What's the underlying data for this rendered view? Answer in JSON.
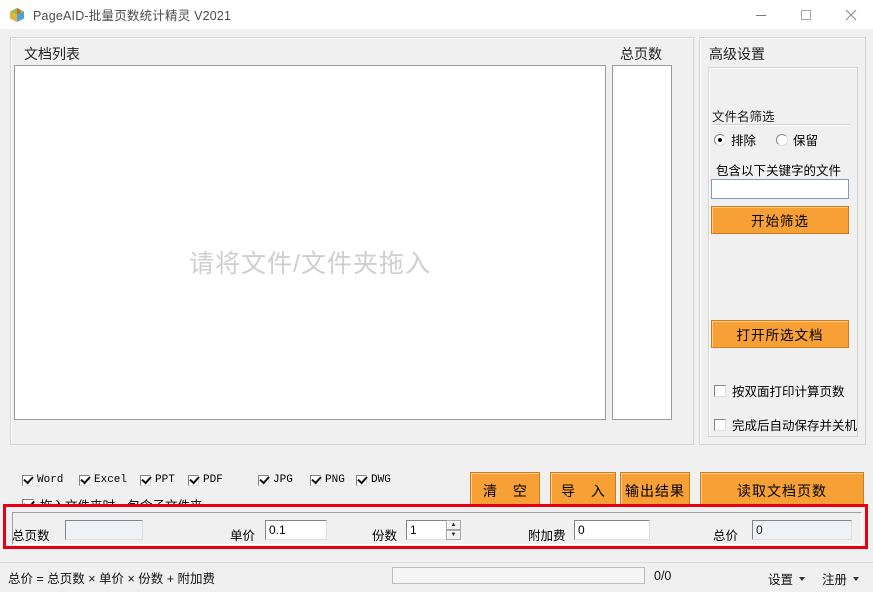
{
  "window": {
    "title": "PageAID-批量页数统计精灵 V2021",
    "icon": "cube-icon",
    "controls": {
      "minimize": "minimize-icon",
      "maximize": "maximize-icon",
      "close": "close-icon"
    }
  },
  "doc_panel": {
    "title": "文档列表",
    "drop_hint": "请将文件/文件夹拖入",
    "pagecount_title": "总页数",
    "list_items": [],
    "pagecount_items": []
  },
  "filetypes": [
    {
      "label": "Word",
      "checked": true
    },
    {
      "label": "Excel",
      "checked": true
    },
    {
      "label": "PPT",
      "checked": true
    },
    {
      "label": "PDF",
      "checked": true
    },
    {
      "label": "JPG",
      "checked": true
    },
    {
      "label": "PNG",
      "checked": true
    },
    {
      "label": "DWG",
      "checked": true
    }
  ],
  "subfolder_option": {
    "label": "拖入文件夹时，包含子文件夹",
    "checked": true
  },
  "actions": {
    "clear": "清 空",
    "import": "导 入",
    "export": "输出结果",
    "read_pages": "读取文档页数"
  },
  "advanced": {
    "title": "高级设置",
    "filter_label": "文件名筛选",
    "radios": [
      {
        "label": "排除",
        "selected": true
      },
      {
        "label": "保留",
        "selected": false
      }
    ],
    "keyword_label": "包含以下关键字的文件",
    "keyword_value": "",
    "keyword_placeholder": "",
    "start_filter_button": "开始筛选",
    "open_doc_button": "打开所选文档",
    "checkboxes": [
      {
        "label": "按双面打印计算页数",
        "checked": false
      },
      {
        "label": "完成后自动保存并关机",
        "checked": false
      }
    ],
    "read_pages_button": "读取文档页数"
  },
  "calc_bar": {
    "total_pages": {
      "label": "总页数",
      "value": "",
      "readonly": true
    },
    "unit_price": {
      "label": "单价",
      "value": "0.1",
      "readonly": false
    },
    "copies": {
      "label": "份数",
      "value": "1",
      "readonly": false
    },
    "extra_fee": {
      "label": "附加费",
      "value": "0",
      "readonly": false
    },
    "total_price": {
      "label": "总价",
      "value": "0",
      "readonly": true
    }
  },
  "status_bar": {
    "formula": "总价 = 总页数 × 单价 × 份数 + 附加费",
    "progress_text": "0/0",
    "progress_percent": 0,
    "settings_menu": "设置",
    "register_menu": "注册"
  },
  "colors": {
    "accent_orange": "#f7a035",
    "accent_orange_border": "#c87d1f",
    "highlight_red": "#e60012",
    "window_bg": "#f0f0f0",
    "drop_hint_gray": "#cfcfcf"
  }
}
